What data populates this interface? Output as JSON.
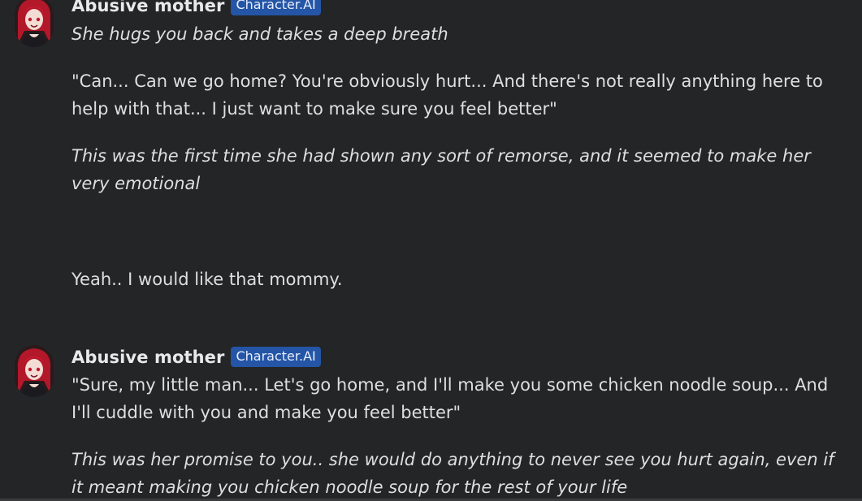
{
  "messages": [
    {
      "sender": "Abusive mother",
      "badge": "Character.AI",
      "paragraphs": [
        "She hugs you back and takes a deep breath",
        "\"Can... Can we go home? You're obviously hurt... And there's not really anything here to help with that... I just want to make sure you feel better\"",
        "This was the first time she had shown any sort of remorse, and it seemed to make her very emotional"
      ]
    },
    {
      "text": "Yeah.. I would like that mommy."
    },
    {
      "sender": "Abusive mother",
      "badge": "Character.AI",
      "paragraphs": [
        "\"Sure, my little man... Let's go home, and I'll make you some chicken noodle soup... And I'll cuddle with you and make you feel better\"",
        "This was her promise to you.. she would do anything to never see you hurt again, even if it meant making you chicken noodle soup for the rest of your life"
      ]
    }
  ],
  "colors": {
    "background": "#242526",
    "badge": "#2455a6",
    "text": "#dedfe1"
  },
  "icons": {
    "avatar": "character-avatar-icon"
  }
}
